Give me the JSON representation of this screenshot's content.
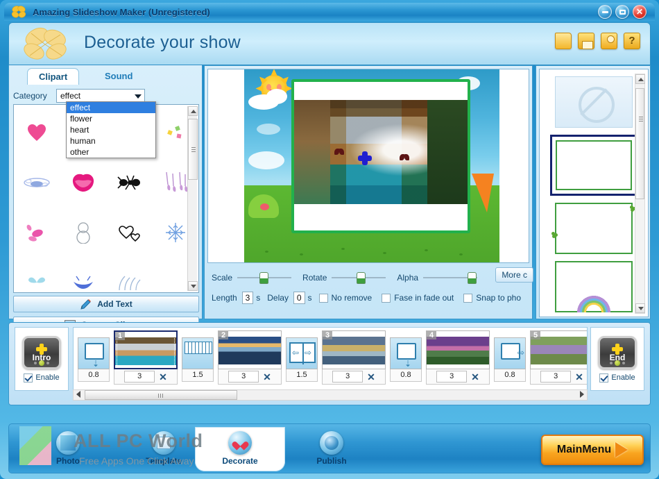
{
  "window": {
    "title": "Amazing Slideshow Maker (Unregistered)",
    "minimize_label": "Minimize",
    "maximize_label": "Maximize",
    "close_label": "Close"
  },
  "header": {
    "title": "Decorate your show",
    "tools": [
      {
        "name": "open-icon",
        "label": "Open"
      },
      {
        "name": "save-icon",
        "label": "Save"
      },
      {
        "name": "register-icon",
        "label": "Register"
      },
      {
        "name": "help-icon",
        "label": "?"
      }
    ]
  },
  "left_panel": {
    "tabs": [
      {
        "label": "Clipart",
        "active": true
      },
      {
        "label": "Sound",
        "active": false
      }
    ],
    "category_label": "Category",
    "category_value": "effect",
    "dropdown_open": true,
    "dropdown_options": [
      "effect",
      "flower",
      "heart",
      "human",
      "other"
    ],
    "dropdown_selected": "effect",
    "clipart_items": [
      "heart-clipart",
      "confetti-clipart",
      "ribbon-clipart",
      "sparkle-clipart",
      "bubbles-clipart",
      "lips-clipart",
      "ant-clipart",
      "blossom-clipart",
      "petal-clipart",
      "snowman-outline-clipart",
      "hearts-outline-clipart",
      "snowflake-clipart",
      "butterfly-clipart",
      "splash-clipart",
      "grass-clipart",
      "empty-clipart"
    ],
    "add_text_label": "Add Text",
    "custom_clipart_label": "Custom Clipart..."
  },
  "preview": {
    "sliders": [
      {
        "label": "Scale",
        "value": 45
      },
      {
        "label": "Rotate",
        "value": 50
      },
      {
        "label": "Alpha",
        "value": 92
      }
    ],
    "more_button": "More c",
    "length_label": "Length",
    "length_value": "3",
    "length_unit": "s",
    "delay_label": "Delay",
    "delay_value": "0",
    "delay_unit": "s",
    "checkboxes": [
      {
        "label": "No remove",
        "checked": false
      },
      {
        "label": "Fase in fade out",
        "checked": false
      },
      {
        "label": "Snap to pho",
        "checked": false
      }
    ]
  },
  "frames_panel": {
    "items": [
      {
        "name": "frame-none",
        "selected": false
      },
      {
        "name": "frame-green-plain",
        "selected": true
      },
      {
        "name": "frame-green-clover",
        "selected": false
      },
      {
        "name": "frame-green-rainbow",
        "selected": false
      }
    ]
  },
  "filmstrip": {
    "intro": {
      "label": "Intro",
      "enable_label": "Enable",
      "enabled": true
    },
    "end": {
      "label": "End",
      "enable_label": "Enable",
      "enabled": true
    },
    "transitions": [
      {
        "icon": "push-down-transition",
        "value": "0.8"
      },
      {
        "icon": "blinds-transition",
        "value": "1.5"
      },
      {
        "icon": "door-open-transition",
        "value": "1.5"
      },
      {
        "icon": "push-down-transition",
        "value": "0.8"
      },
      {
        "icon": "push-right-transition",
        "value": "0.8"
      }
    ],
    "slides": [
      {
        "number": "1",
        "duration": "3",
        "selected": true,
        "image": "cave-beach-photo"
      },
      {
        "number": "2",
        "duration": "3",
        "selected": false,
        "image": "sunset-mountains-photo"
      },
      {
        "number": "3",
        "duration": "3",
        "selected": false,
        "image": "stormy-lake-photo"
      },
      {
        "number": "4",
        "duration": "3",
        "selected": false,
        "image": "purple-sunset-photo"
      },
      {
        "number": "5",
        "duration": "3",
        "selected": false,
        "image": "lavender-trees-photo"
      }
    ],
    "delete_label": "✕"
  },
  "bottom_nav": {
    "tabs": [
      {
        "label": "Photo",
        "icon": "photo-icon",
        "active": false
      },
      {
        "label": "Template",
        "icon": "template-icon",
        "active": false
      },
      {
        "label": "Decorate",
        "icon": "decorate-heart-icon",
        "active": true
      },
      {
        "label": "Publish",
        "icon": "publish-globe-icon",
        "active": false
      }
    ],
    "main_menu_label": "MainMenu"
  },
  "watermark": {
    "line1": "ALL PC World",
    "line2": "Free Apps One Click Away"
  }
}
